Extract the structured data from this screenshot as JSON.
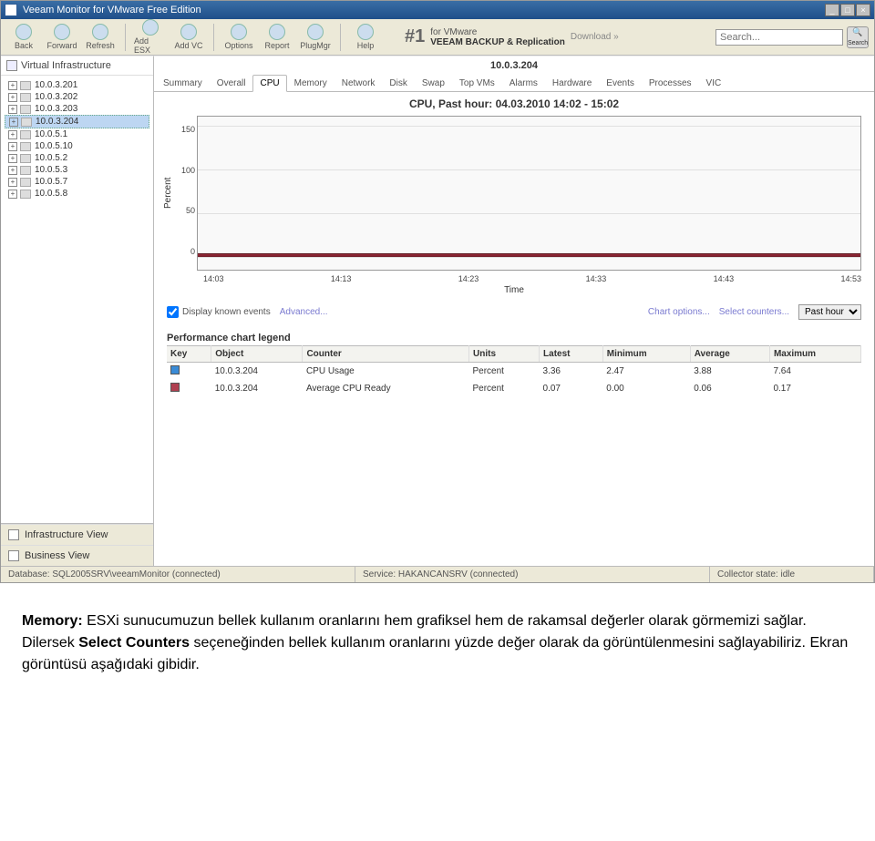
{
  "window": {
    "title": "Veeam Monitor for VMware Free Edition"
  },
  "toolbar": {
    "buttons": [
      "Back",
      "Forward",
      "Refresh",
      "Add ESX",
      "Add VC",
      "Options",
      "Report",
      "PlugMgr",
      "Help"
    ],
    "banner_num": "#1",
    "banner_tag": "for VMware",
    "banner_product": "VEEAM BACKUP & Replication",
    "banner_link": "Download »",
    "search_placeholder": "Search...",
    "search_btn": "Search"
  },
  "sidebar": {
    "header": "Virtual Infrastructure",
    "items": [
      {
        "label": "10.0.3.201",
        "exp": "+"
      },
      {
        "label": "10.0.3.202",
        "exp": "+"
      },
      {
        "label": "10.0.3.203",
        "exp": "+"
      },
      {
        "label": "10.0.3.204",
        "exp": "+",
        "selected": true
      },
      {
        "label": "10.0.5.1",
        "exp": "+"
      },
      {
        "label": "10.0.5.10",
        "exp": "+"
      },
      {
        "label": "10.0.5.2",
        "exp": "+"
      },
      {
        "label": "10.0.5.3",
        "exp": "+"
      },
      {
        "label": "10.0.5.7",
        "exp": "+"
      },
      {
        "label": "10.0.5.8",
        "exp": "+"
      }
    ],
    "tabs": {
      "infra": "Infrastructure View",
      "business": "Business View"
    }
  },
  "content": {
    "host_title": "10.0.3.204",
    "tabs": [
      "Summary",
      "Overall",
      "CPU",
      "Memory",
      "Network",
      "Disk",
      "Swap",
      "Top VMs",
      "Alarms",
      "Hardware",
      "Events",
      "Processes",
      "VIC"
    ],
    "active_tab": "CPU",
    "chart_title": "CPU, Past hour: 04.03.2010 14:02 - 15:02",
    "ylabel": "Percent",
    "xlabel": "Time",
    "opts": {
      "display_known": "Display known events",
      "advanced": "Advanced...",
      "chart_options": "Chart options...",
      "select_counters": "Select counters...",
      "period": "Past hour"
    },
    "legend_title": "Performance chart legend",
    "legend_headers": [
      "Key",
      "Object",
      "Counter",
      "Units",
      "Latest",
      "Minimum",
      "Average",
      "Maximum"
    ],
    "legend_rows": [
      {
        "color": "#3a8bd6",
        "object": "10.0.3.204",
        "counter": "CPU Usage",
        "units": "Percent",
        "latest": "3.36",
        "min": "2.47",
        "avg": "3.88",
        "max": "7.64"
      },
      {
        "color": "#b04050",
        "object": "10.0.3.204",
        "counter": "Average CPU Ready",
        "units": "Percent",
        "latest": "0.07",
        "min": "0.00",
        "avg": "0.06",
        "max": "0.17"
      }
    ]
  },
  "chart_data": {
    "type": "line",
    "xlabel": "Time",
    "ylabel": "Percent",
    "ylim": [
      0,
      150
    ],
    "x_ticks": [
      "14:03",
      "14:13",
      "14:23",
      "14:33",
      "14:43",
      "14:53"
    ],
    "y_ticks": [
      0,
      50,
      100,
      150
    ],
    "series": [
      {
        "name": "CPU Usage",
        "color": "#3a8bd6",
        "approx_flat_value": 3.9
      },
      {
        "name": "Average CPU Ready",
        "color": "#b04050",
        "approx_flat_value": 0.06
      }
    ]
  },
  "statusbar": {
    "db": "Database: SQL2005SRV\\veeamMonitor (connected)",
    "service": "Service: HAKANCANSRV (connected)",
    "collector": "Collector state: idle"
  },
  "below": {
    "p1_bold": "Memory:",
    "p1_rest": " ESXi sunucumuzun bellek kullanım oranlarını hem grafiksel hem de rakamsal değerler olarak görmemizi sağlar. Dilersek ",
    "p1_bold2": "Select Counters",
    "p1_rest2": " seçeneğinden bellek kullanım oranlarını yüzde değer olarak da görüntülenmesini sağlayabiliriz. Ekran görüntüsü aşağıdaki gibidir."
  }
}
